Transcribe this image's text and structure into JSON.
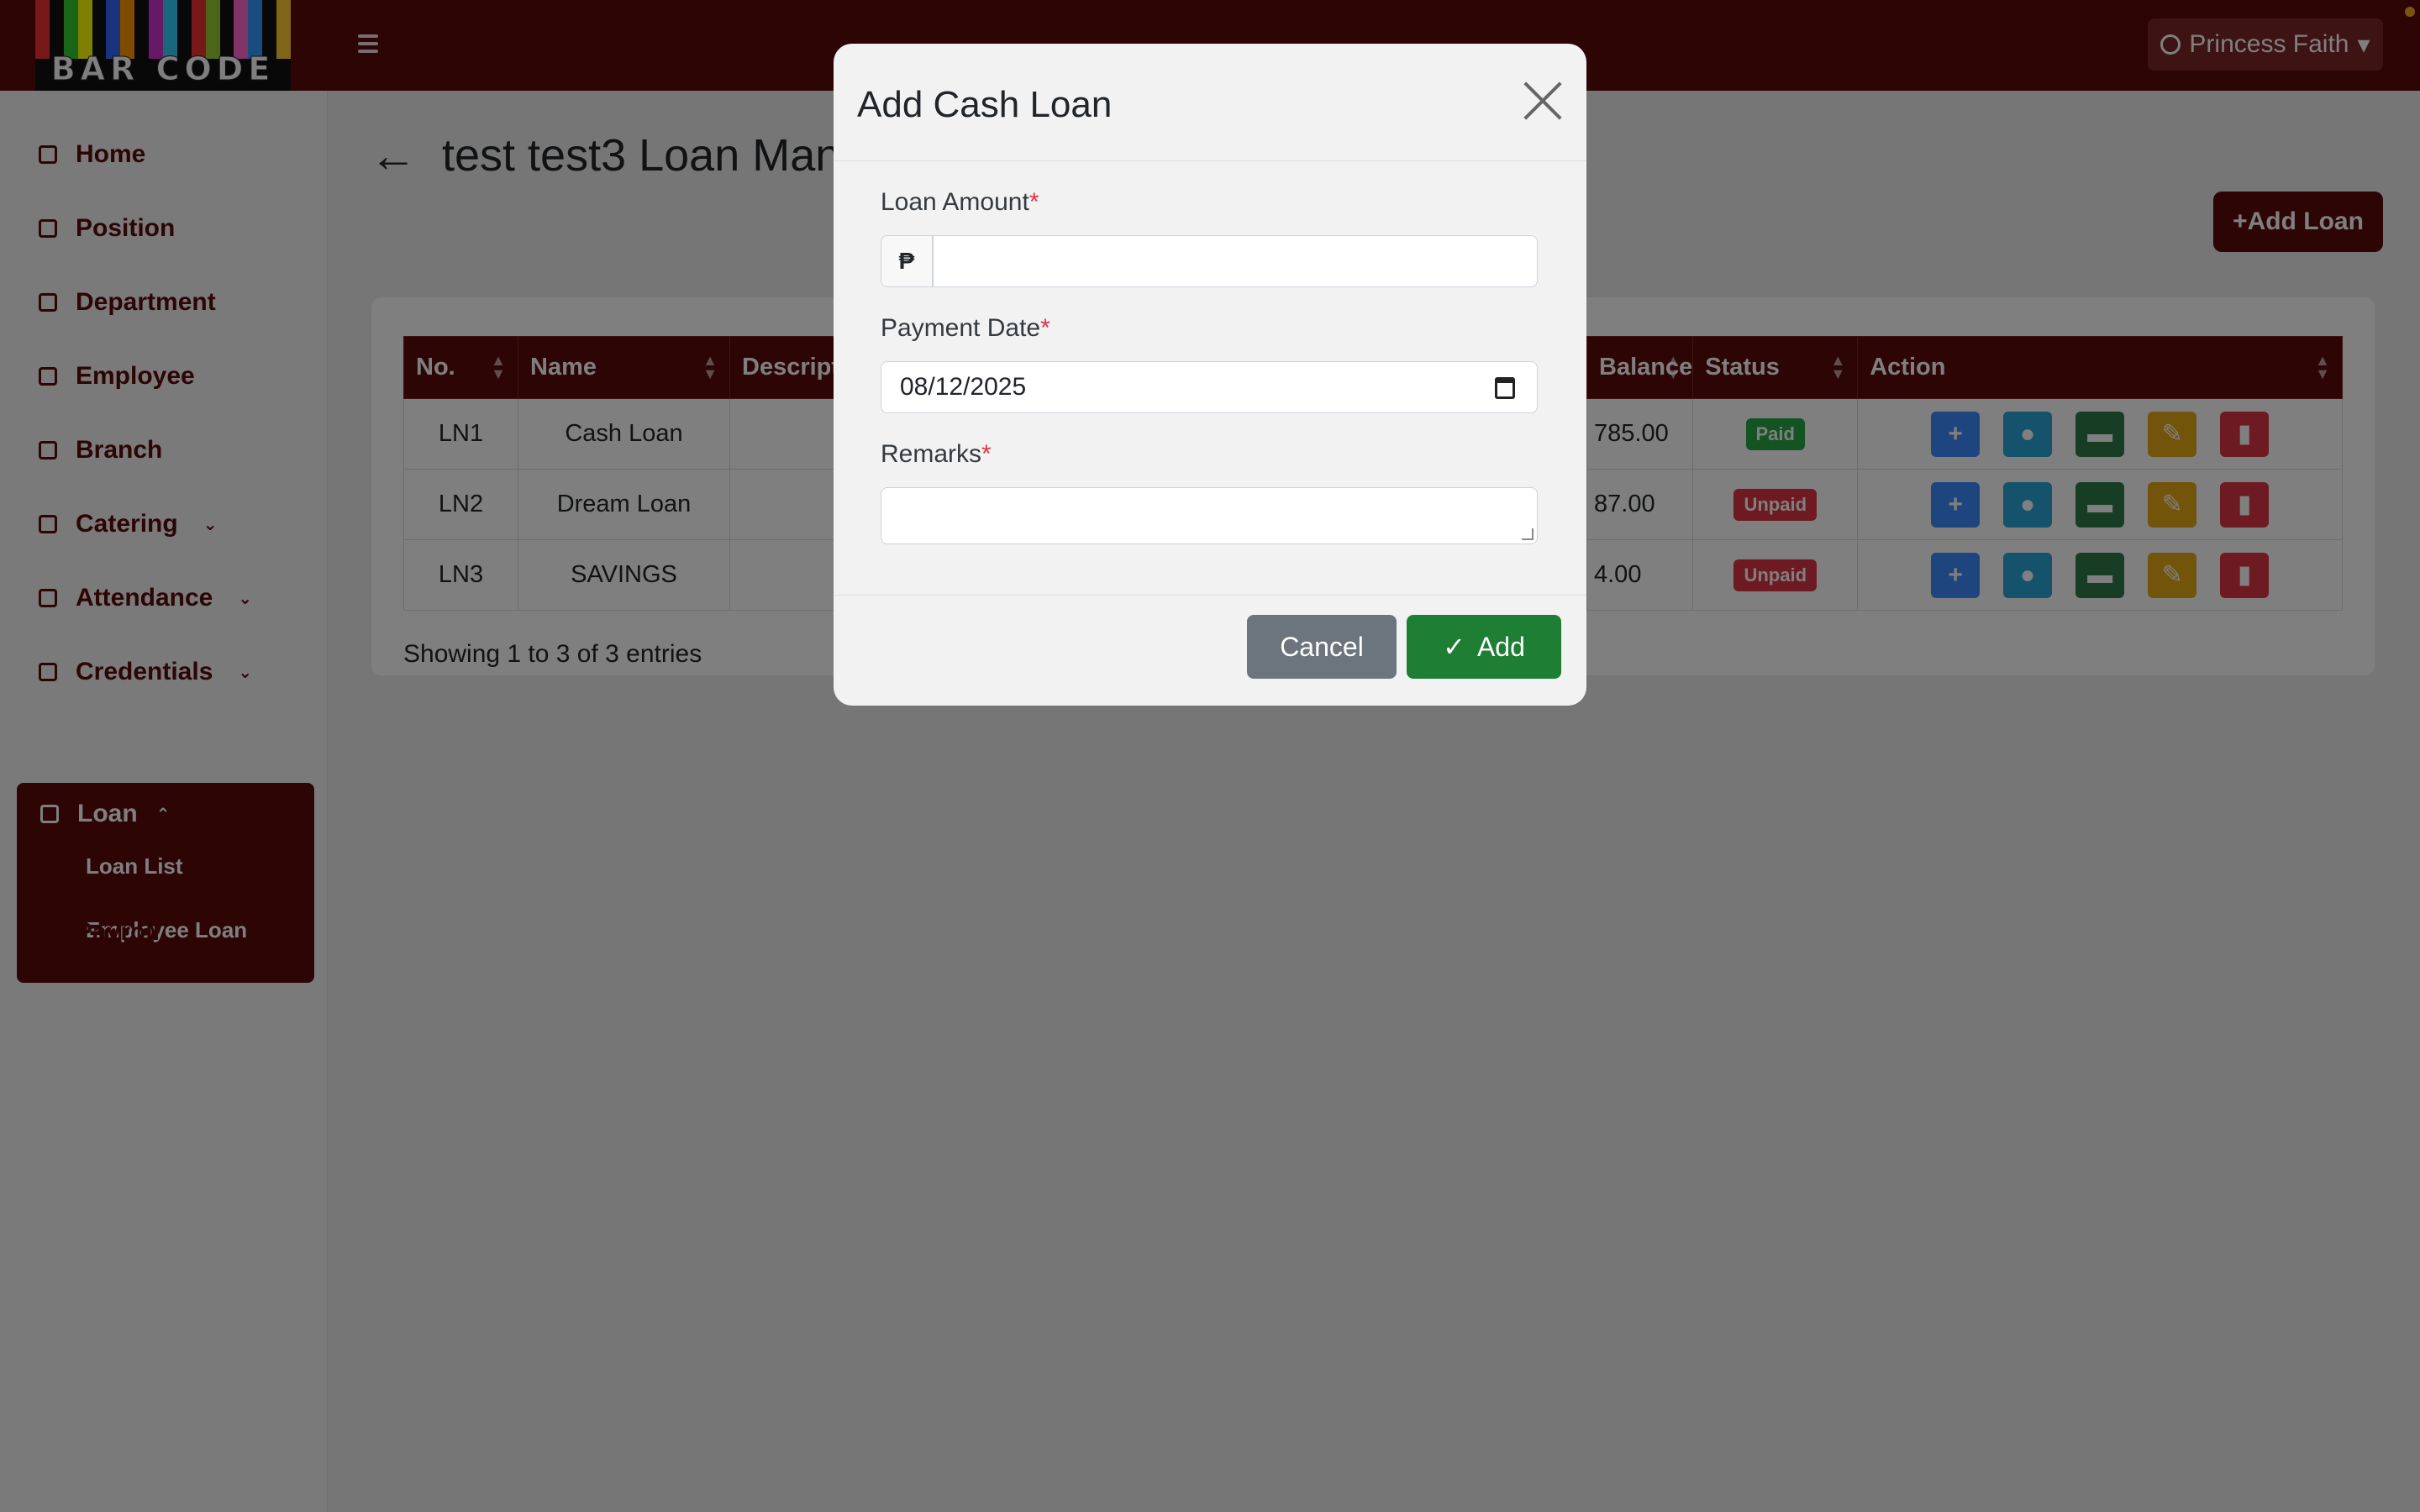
{
  "app": {
    "logo_text": "BAR CODE",
    "user_name": "Princess Faith"
  },
  "sidebar": {
    "items": [
      {
        "label": "Home"
      },
      {
        "label": "Position"
      },
      {
        "label": "Department"
      },
      {
        "label": "Employee"
      },
      {
        "label": "Branch"
      },
      {
        "label": "Catering"
      },
      {
        "label": "Attendance"
      },
      {
        "label": "Credentials"
      },
      {
        "label": "Loan"
      },
      {
        "label": "Payroll"
      }
    ],
    "loan_sub": [
      "Loan List",
      "Employee Loan"
    ]
  },
  "page": {
    "title": "test test3 Loan Management",
    "add_loan_label": "+Add Loan",
    "showing": "Showing 1 to 3 of 3 entries"
  },
  "table": {
    "headers": [
      "No.",
      "Name",
      "Description",
      "Balance",
      "Status",
      "Action"
    ],
    "rows": [
      {
        "no": "LN1",
        "name": "Cash Loan",
        "balance": "785.00",
        "status": "Paid"
      },
      {
        "no": "LN2",
        "name": "Dream Loan",
        "balance": "87.00",
        "status": "Unpaid"
      },
      {
        "no": "LN3",
        "name": "SAVINGS",
        "balance": "4.00",
        "status": "Unpaid"
      }
    ]
  },
  "modal": {
    "title": "Add Cash Loan",
    "loan_amount_label": "Loan Amount",
    "currency_symbol": "₱",
    "payment_date_label": "Payment Date",
    "payment_date_value": "08/12/2025",
    "remarks_label": "Remarks",
    "required_mark": "*",
    "cancel_label": "Cancel",
    "add_label": "Add"
  },
  "colors": {
    "brand": "#5a0a0a",
    "paid": "#28a745",
    "unpaid": "#dc3545",
    "add_btn": "#1e7e34",
    "cancel_btn": "#6c757d"
  }
}
